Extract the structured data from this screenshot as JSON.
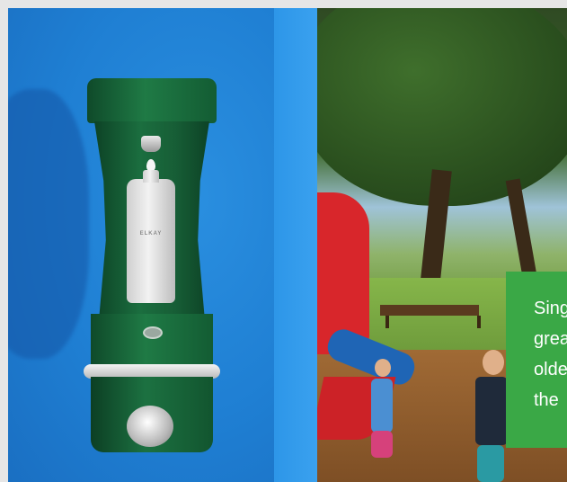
{
  "filler": {
    "brand": "ELKAY",
    "colors": {
      "body": "#1b6e3f",
      "wall": "#1f7fd3"
    },
    "icons": [
      "spout-icon",
      "water-drop-icon",
      "bottle-icon",
      "sensor-button-icon"
    ]
  },
  "caption": {
    "lines": [
      "Sing",
      "grea",
      "olde",
      "the"
    ],
    "background": "#3aa846"
  }
}
